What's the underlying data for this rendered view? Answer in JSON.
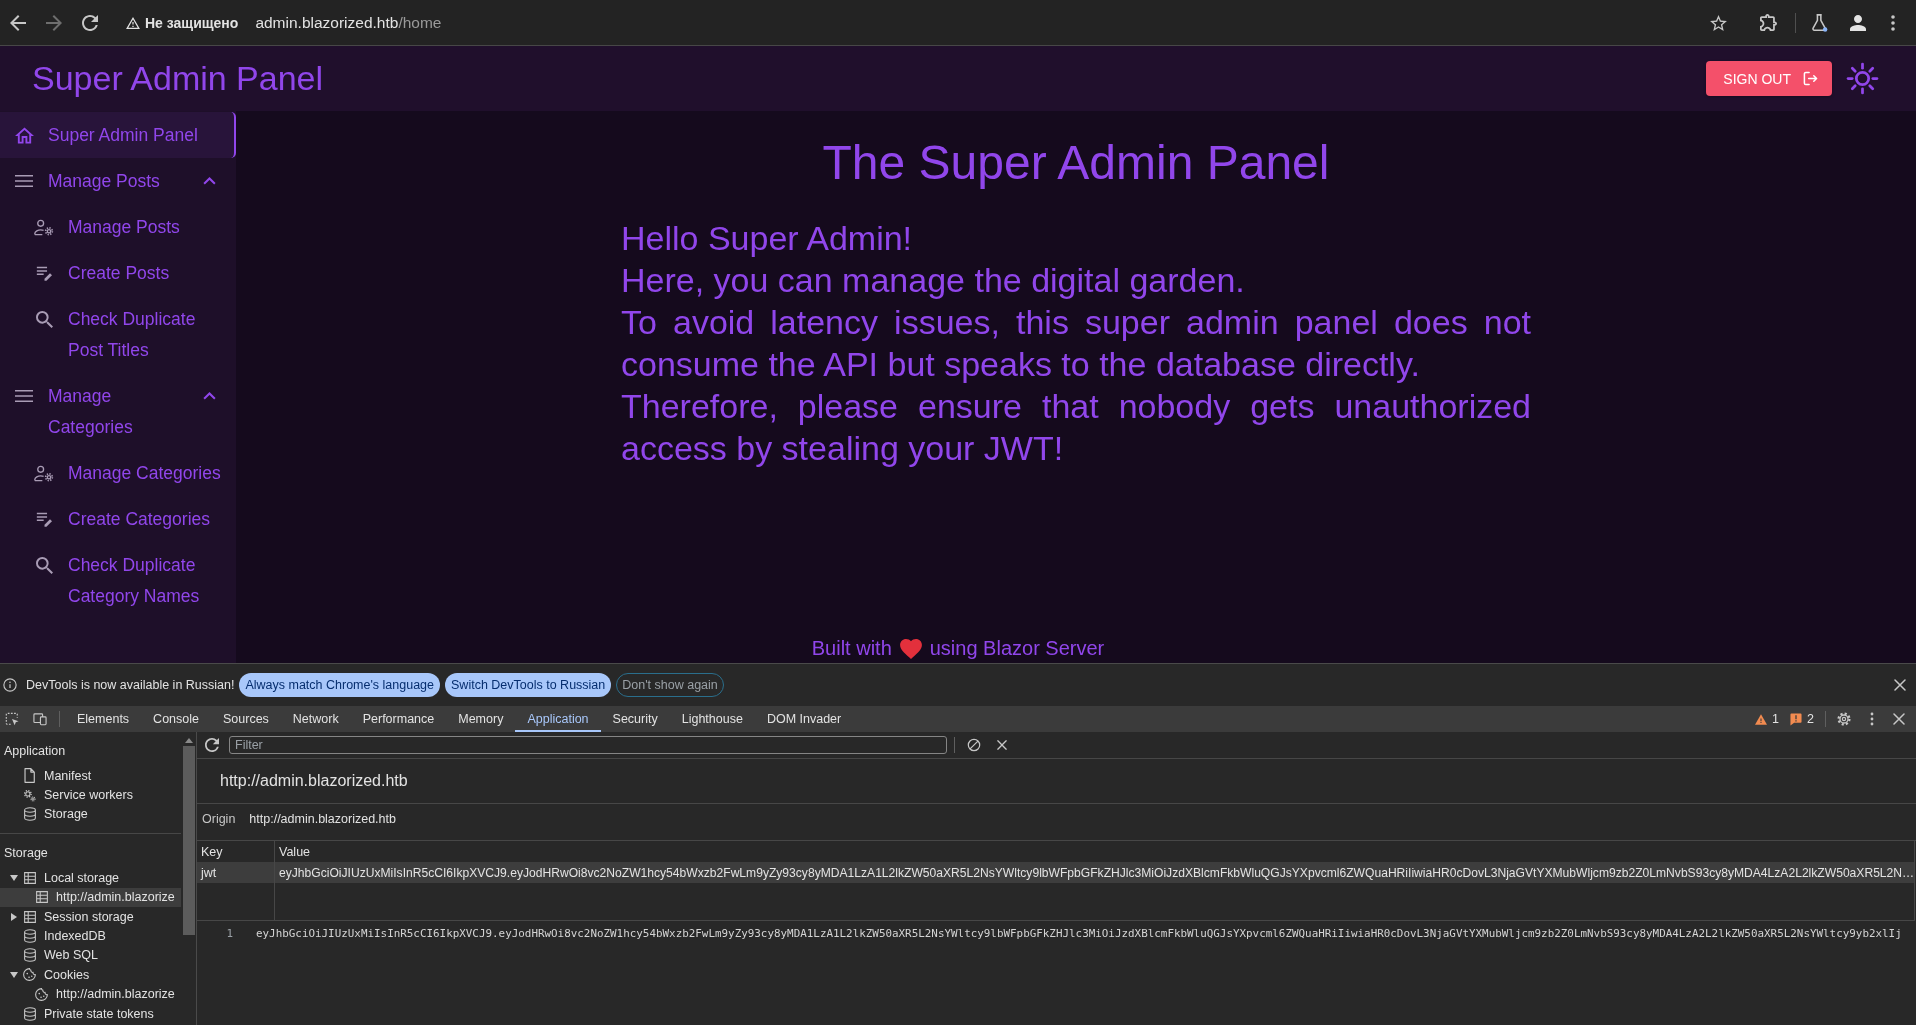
{
  "browser": {
    "navigation": {
      "back_disabled": false,
      "forward_disabled": true
    },
    "security_label": "Не защищено",
    "url": {
      "host": "admin.blazorized.htb",
      "path": "/home"
    }
  },
  "header": {
    "title": "Super Admin Panel",
    "sign_out": "SIGN OUT"
  },
  "sidebar": {
    "items": [
      {
        "kind": "link",
        "label": "Super Admin Panel",
        "selected": true
      },
      {
        "kind": "group",
        "label": "Manage Posts",
        "expanded": true,
        "selected": false,
        "children": [
          {
            "kind": "manage",
            "label": "Manage Posts",
            "selected": false
          },
          {
            "kind": "create",
            "label": "Create Posts",
            "selected": false
          },
          {
            "kind": "check",
            "label": "Check Duplicate Post Titles",
            "selected": false
          }
        ]
      },
      {
        "kind": "group",
        "label": "Manage Categories",
        "expanded": true,
        "selected": false,
        "children": [
          {
            "kind": "manage",
            "label": "Manage Categories",
            "selected": false
          },
          {
            "kind": "create",
            "label": "Create Categories",
            "selected": false
          },
          {
            "kind": "check",
            "label": "Check Duplicate Category Names",
            "selected": false
          }
        ]
      }
    ]
  },
  "main": {
    "title": "The Super Admin Panel",
    "intro_lines": [
      "Hello Super Admin!",
      "Here, you can manage the digital garden.",
      "To avoid latency issues, this super admin panel does not consume the API but speaks to the database directly.",
      "Therefore, please ensure that nobody gets unauthorized access by stealing your JWT!"
    ]
  },
  "footer": {
    "text_before_icon": "Built with",
    "text_after_icon": "using Blazor Server"
  },
  "devtools": {
    "infobar": {
      "message": "DevTools is now available in Russian!",
      "buttons": [
        {
          "kind": "filled",
          "label": "Always match Chrome's language"
        },
        {
          "kind": "filled",
          "label": "Switch DevTools to Russian"
        },
        {
          "kind": "outlined",
          "label": "Don't show again"
        }
      ]
    },
    "tabs": [
      {
        "label": "Elements",
        "selected": false
      },
      {
        "label": "Console",
        "selected": false
      },
      {
        "label": "Sources",
        "selected": false
      },
      {
        "label": "Network",
        "selected": false
      },
      {
        "label": "Performance",
        "selected": false
      },
      {
        "label": "Memory",
        "selected": false
      },
      {
        "label": "Application",
        "selected": true
      },
      {
        "label": "Security",
        "selected": false
      },
      {
        "label": "Lighthouse",
        "selected": false
      },
      {
        "label": "DOM Invader",
        "selected": false
      }
    ],
    "warning_count": "1",
    "issue_count": "2",
    "sidebar": {
      "sections": [
        {
          "title": "Application",
          "items": [
            {
              "kind": "file",
              "label": "Manifest",
              "selected": false
            },
            {
              "kind": "gears",
              "label": "Service workers",
              "selected": false
            },
            {
              "kind": "database",
              "label": "Storage",
              "selected": false
            }
          ]
        },
        {
          "title": "Storage",
          "items": [
            {
              "kind": "table",
              "label": "Local storage",
              "expanded": true,
              "selected": false,
              "children": [
                {
                  "kind": "table",
                  "label": "http://admin.blazorize",
                  "selected": true
                }
              ]
            },
            {
              "kind": "table",
              "label": "Session storage",
              "expanded": false,
              "selected": false
            },
            {
              "kind": "database",
              "label": "IndexedDB",
              "selected": false
            },
            {
              "kind": "database",
              "label": "Web SQL",
              "selected": false
            },
            {
              "kind": "cookie",
              "label": "Cookies",
              "expanded": true,
              "selected": false,
              "children": [
                {
                  "kind": "cookie",
                  "label": "http://admin.blazorize",
                  "selected": false
                }
              ]
            },
            {
              "kind": "database",
              "label": "Private state tokens",
              "selected": false
            }
          ]
        }
      ]
    },
    "filter": {
      "placeholder": "Filter"
    },
    "origin_title": "http://admin.blazorized.htb",
    "origin": {
      "label": "Origin",
      "value": "http://admin.blazorized.htb"
    },
    "table": {
      "columns": [
        "Key",
        "Value"
      ],
      "rows": [
        {
          "cells": [
            "jwt",
            "eyJhbGciOiJIUzUxMiIsInR5cCI6IkpXVCJ9.eyJodHRwOi8vc2NoZW1hcy54bWxzb2FwLm9yZy93cy8yMDA1LzA1L2lkZW50aXR5L2NsYWltcy9lbWFpbGFkZHJlc3MiOiJzdXBlcmFkbWluQGJsYXpvcml6ZWQuaHRiIiwiaHR0cDovL3NjaGVtYXMubWljcm9zb2Z0LmNvbS93cy8yMDA4LzA2L2lkZW50aXR5L2N…"
          ],
          "selected": true
        }
      ]
    },
    "preview": {
      "line_number": "1",
      "text": "eyJhbGciOiJIUzUxMiIsInR5cCI6IkpXVCJ9.eyJodHRwOi8vc2NoZW1hcy54bWxzb2FwLm9yZy93cy8yMDA1LzA1L2lkZW50aXR5L2NsYWltcy9lbWFpbGFkZHJlc3MiOiJzdXBlcmFkbWluQGJsYXpvcml6ZWQuaHRiIiwiaHR0cDovL3NjaGVtYXMubWljcm9zb2Z0LmNvbS93cy8yMDA4LzA2L2lkZW50aXR5L2NsYWltcy9yb2xlIj"
    }
  }
}
